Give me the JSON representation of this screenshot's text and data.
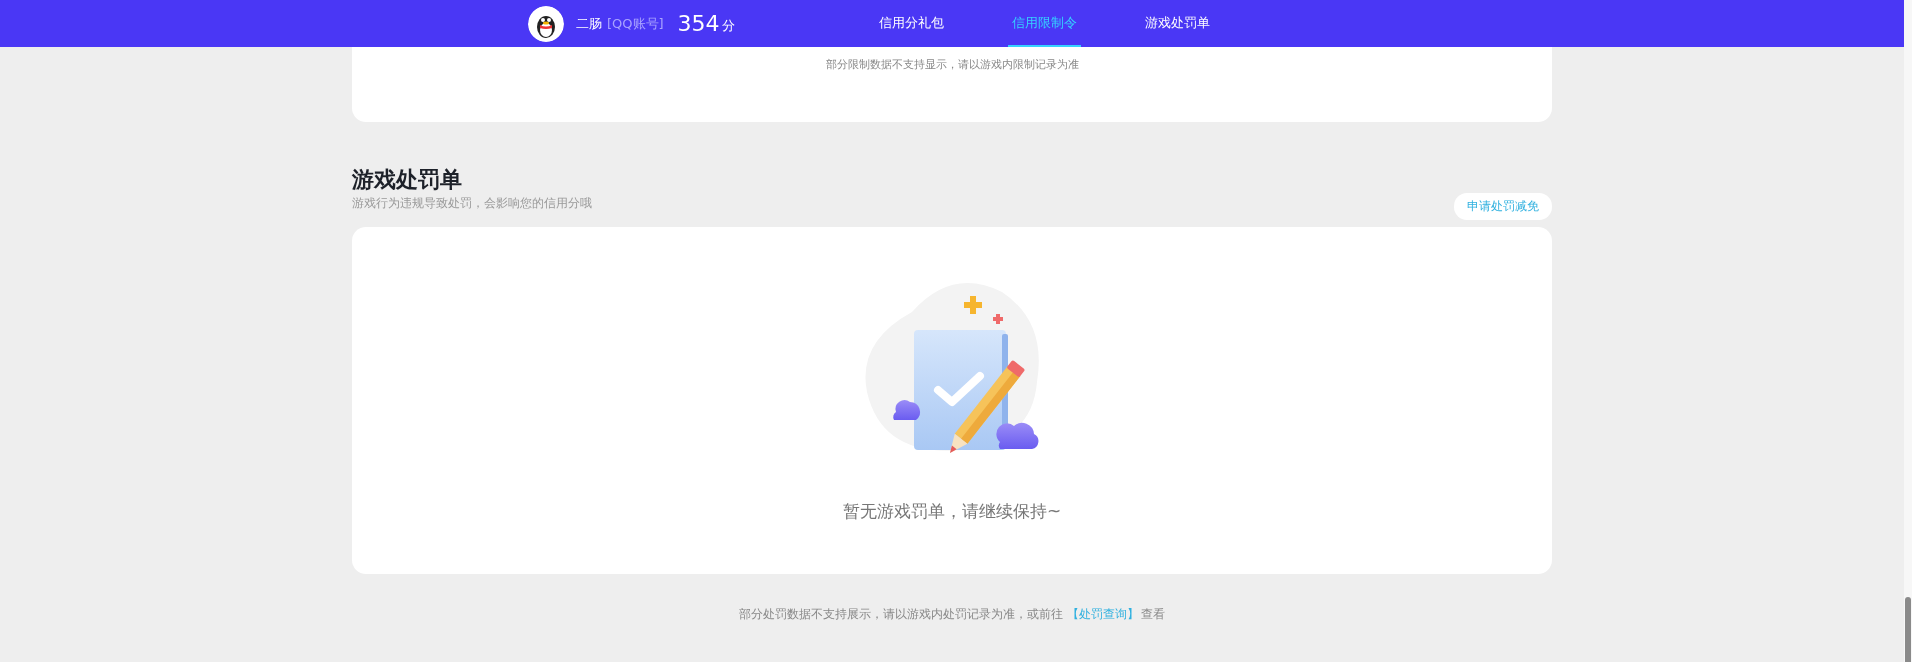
{
  "header": {
    "user": {
      "name": "二肠",
      "account_tag": "[QQ账号]",
      "score": "354",
      "score_unit": "分"
    },
    "nav": [
      {
        "label": "信用分礼包",
        "selected": false
      },
      {
        "label": "信用限制令",
        "selected": true
      },
      {
        "label": "游戏处罚单",
        "selected": false
      }
    ]
  },
  "restriction_section": {
    "notice": "部分限制数据不支持显示，请以游戏内限制记录为准"
  },
  "penalty_section": {
    "title": "游戏处罚单",
    "subtitle": "游戏行为违规导致处罚，会影响您的信用分哦",
    "appeal_button": "申请处罚减免",
    "empty_message": "暂无游戏罚单，请继续保持~"
  },
  "footer": {
    "text": "部分处罚数据不支持展示，请以游戏内处罚记录为准，或前往",
    "link": "【处罚查询】",
    "suffix": "查看"
  }
}
